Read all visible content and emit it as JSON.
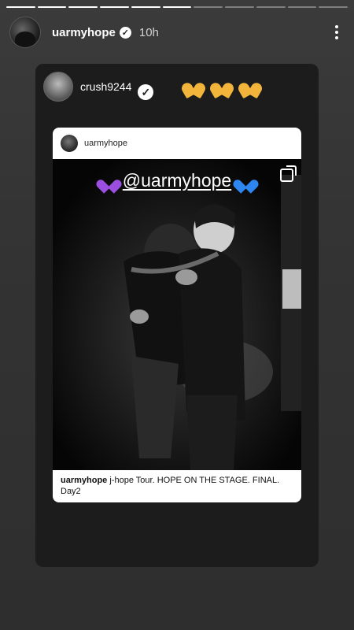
{
  "story": {
    "segments_total": 11,
    "segments_done": 6
  },
  "header": {
    "username": "uarmyhope",
    "verified": true,
    "time": "10h",
    "more_icon": "more-vertical-icon"
  },
  "shared": {
    "username": "crush9244",
    "verified": true,
    "sticker": "heart-hands-emoji x3",
    "sticker_color": "#f2b43a"
  },
  "post": {
    "username": "uarmyhope",
    "photo_caption": {
      "left_emoji": "purple-heart-icon",
      "mention": "@uarmyhope",
      "right_emoji": "blue-heart-icon"
    },
    "multi_icon": "carousel-icon",
    "caption_user": "uarmyhope",
    "caption_text": " j-hope Tour. HOPE ON THE STAGE. FINAL. Day2"
  }
}
